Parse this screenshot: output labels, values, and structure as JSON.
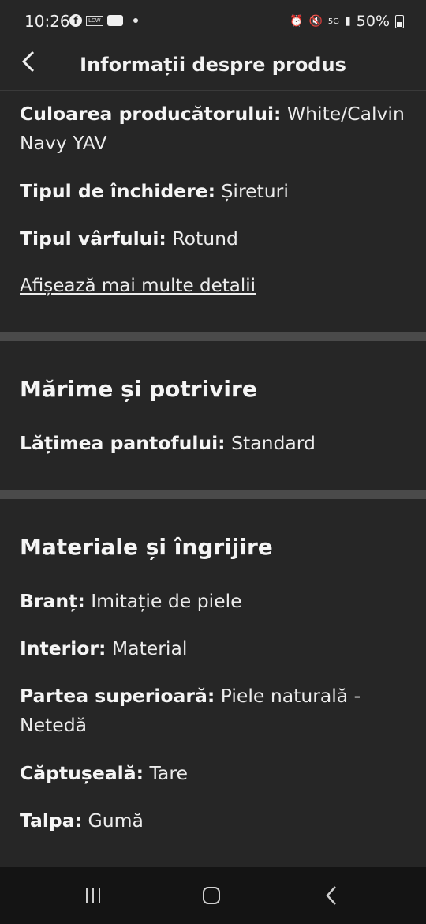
{
  "status_bar": {
    "time": "10:26",
    "left_icons": {
      "lcw": "LCW"
    },
    "battery": "50%",
    "network": "5G"
  },
  "header": {
    "back_icon": "chevron-left-icon",
    "title": "Informații despre produs"
  },
  "details": {
    "manufacturer_color": {
      "label": "Culoarea producătorului:",
      "value": "White/Calvin Navy YAV"
    },
    "closure_type": {
      "label": "Tipul de închidere:",
      "value": "Șireturi"
    },
    "toe_type": {
      "label": "Tipul vârfului:",
      "value": "Rotund"
    },
    "more_details_link": "Afișează mai multe detalii"
  },
  "size_fit": {
    "title": "Mărime și potrivire",
    "width": {
      "label": "Lățimea pantofului:",
      "value": "Standard"
    }
  },
  "materials": {
    "title": "Materiale și îngrijire",
    "rows": [
      {
        "label": "Branț:",
        "value": "Imitație de piele"
      },
      {
        "label": "Interior:",
        "value": "Material"
      },
      {
        "label": "Partea superioară:",
        "value": "Piele naturală - Netedă"
      },
      {
        "label": "Căptușeală:",
        "value": "Tare"
      },
      {
        "label": "Talpa:",
        "value": "Gumă"
      }
    ]
  },
  "nav_bar": {
    "recents_icon": "recents-icon",
    "home_icon": "home-icon",
    "back_icon": "back-icon"
  }
}
